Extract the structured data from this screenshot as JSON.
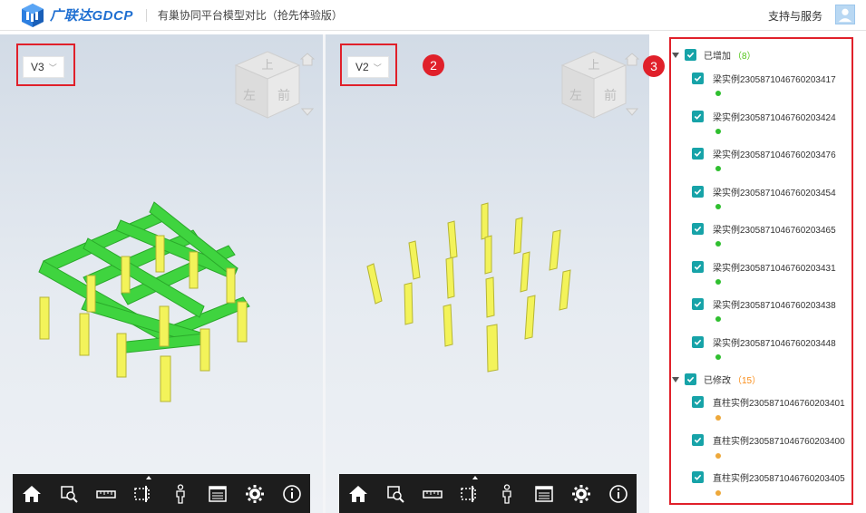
{
  "header": {
    "logo_text": "广联达GDCP",
    "title": "有巢协同平台模型对比（抢先体验版）",
    "support_label": "支持与服务",
    "avatar_icon": "user-avatar-icon"
  },
  "viewports": [
    {
      "version": "V3",
      "cube_labels": {
        "top": "上",
        "left": "左",
        "front": "前"
      }
    },
    {
      "version": "V2",
      "cube_labels": {
        "top": "上",
        "left": "左",
        "front": "前"
      },
      "badge": "2"
    }
  ],
  "toolbar": {
    "icons": [
      "home-icon",
      "zoom-fit-icon",
      "measure-ruler-icon",
      "section-box-icon",
      "person-walk-icon",
      "properties-list-icon",
      "settings-gear-icon",
      "info-icon"
    ]
  },
  "panel": {
    "badge": "3",
    "groups": [
      {
        "label": "已增加",
        "count": "（8）",
        "status_color": "#2fbf2f",
        "items": [
          "梁实例2305871046760203417",
          "梁实例2305871046760203424",
          "梁实例2305871046760203476",
          "梁实例2305871046760203454",
          "梁实例2305871046760203465",
          "梁实例2305871046760203431",
          "梁实例2305871046760203438",
          "梁实例2305871046760203448"
        ]
      },
      {
        "label": "已修改",
        "count": "（15）",
        "status_color": "#eea83a",
        "items": [
          "直柱实例2305871046760203401",
          "直柱实例2305871046760203400",
          "直柱实例2305871046760203405"
        ]
      }
    ]
  },
  "colors": {
    "accent_red": "#e0202a",
    "checkbox_teal": "#17a3a8",
    "beam_green": "#3fd43f",
    "column_yellow": "#f3f35a"
  }
}
